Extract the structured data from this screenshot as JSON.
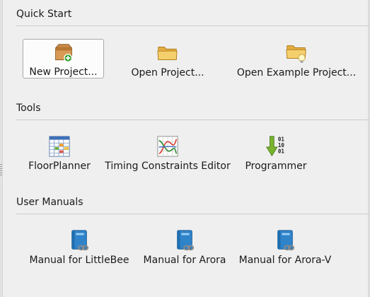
{
  "quick_start": {
    "title": "Quick Start",
    "items": [
      {
        "label": "New Project...",
        "icon": "new-project-box-icon"
      },
      {
        "label": "Open Project...",
        "icon": "folder-icon"
      },
      {
        "label": "Open Example Project...",
        "icon": "folder-lightbulb-icon"
      }
    ]
  },
  "tools": {
    "title": "Tools",
    "items": [
      {
        "label": "FloorPlanner",
        "icon": "floorplanner-grid-icon"
      },
      {
        "label": "Timing Constraints Editor",
        "icon": "timing-graph-icon"
      },
      {
        "label": "Programmer",
        "icon": "programmer-download-icon"
      }
    ]
  },
  "user_manuals": {
    "title": "User Manuals",
    "items": [
      {
        "label": "Manual for LittleBee",
        "icon": "manual-book-icon"
      },
      {
        "label": "Manual for Arora",
        "icon": "manual-book-icon"
      },
      {
        "label": "Manual for Arora-V",
        "icon": "manual-book-icon"
      }
    ]
  },
  "programmer_icon_digits": [
    "01",
    "10",
    "01"
  ],
  "colors": {
    "background": "#efefef",
    "folder": "#f2c661",
    "book": "#2f83c9",
    "arrow": "#6aa521",
    "plus": "#2fa02f"
  }
}
